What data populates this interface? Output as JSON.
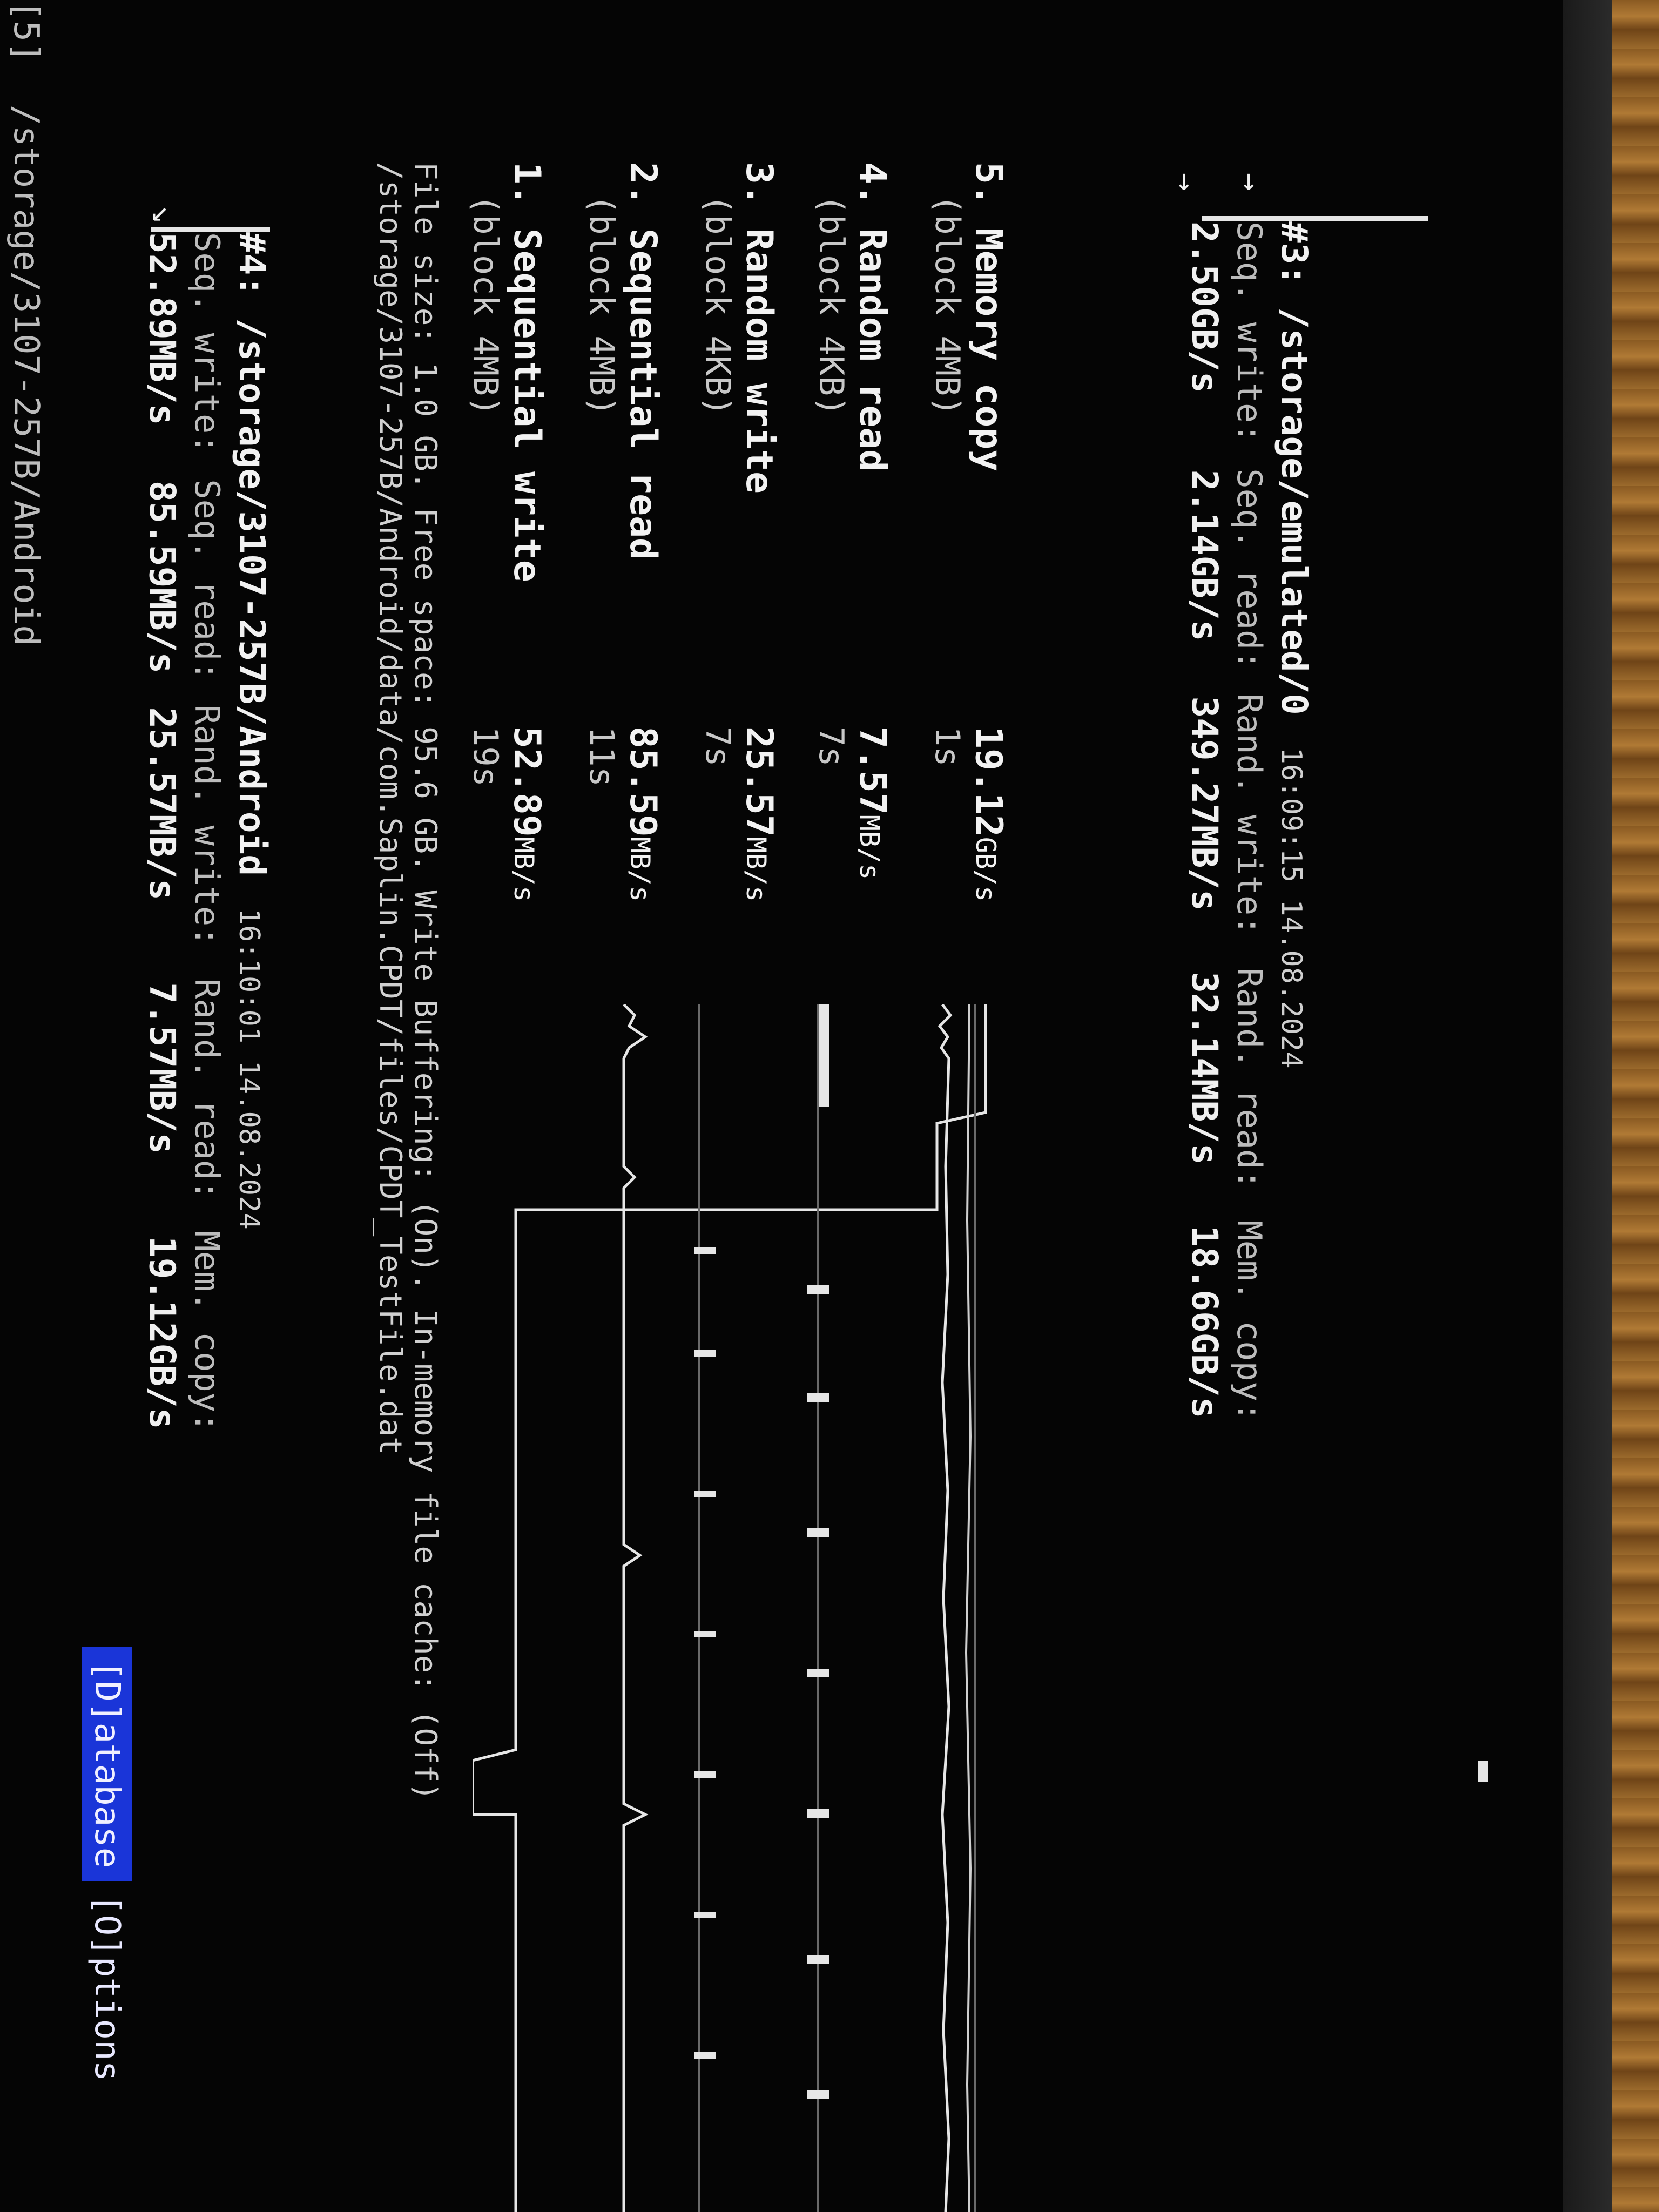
{
  "window": {
    "title_prefix": "[5]",
    "title": "/storage/3107-257B/Android"
  },
  "tabs": [
    {
      "label": "[D]atabase",
      "active": true
    },
    {
      "label": "[O]ptions",
      "active": false
    }
  ],
  "entry4": {
    "header": "#4: /storage/3107-257B/Android",
    "time": "16:10:01 14.08.2024",
    "labels": [
      "Seq. write:",
      "Seq. read:",
      "Rand. write:",
      "Rand. read:",
      "Mem. copy:"
    ],
    "values": [
      "52.89MB/s",
      "85.59MB/s",
      "25.57MB/s",
      "7.57MB/s",
      "19.12GB/s"
    ]
  },
  "file_path": "/storage/3107-257B/Android/data/com.Saplin.CPDT/files/CPDT_TestFile.dat",
  "file_info": "File size: 1.0 GB. Free space: 95.6 GB. Write Buffering: (On). In-memory file cache: (Off)",
  "tests": [
    {
      "name": "1. Sequential write",
      "block": "(block 4MB)",
      "speed": "52.89",
      "unit": "MB/s",
      "time": "19s"
    },
    {
      "name": "2. Sequential read",
      "block": "(block 4MB)",
      "speed": "85.59",
      "unit": "MB/s",
      "time": "11s"
    },
    {
      "name": "3. Random write",
      "block": "(block 4KB)",
      "speed": "25.57",
      "unit": "MB/s",
      "time": "7s"
    },
    {
      "name": "4. Random read",
      "block": "(block 4KB)",
      "speed": "7.57",
      "unit": "MB/s",
      "time": "7s"
    },
    {
      "name": "5. Memory copy",
      "block": "(block 4MB)",
      "speed": "19.12",
      "unit": "GB/s",
      "time": "1s"
    }
  ],
  "entry3": {
    "header": "#3: /storage/emulated/0",
    "time": "16:09:15 14.08.2024",
    "labels": [
      "Seq. write:",
      "Seq. read:",
      "Rand. write:",
      "Rand. read:",
      "Mem. copy:"
    ],
    "values": [
      "2.50GB/s",
      "2.14GB/s",
      "349.27MB/s",
      "32.14MB/s",
      "18.66GB/s"
    ]
  },
  "colors": {
    "tab_active": "#1a35d8",
    "text": "#f2f2f2",
    "background": "#050505"
  }
}
